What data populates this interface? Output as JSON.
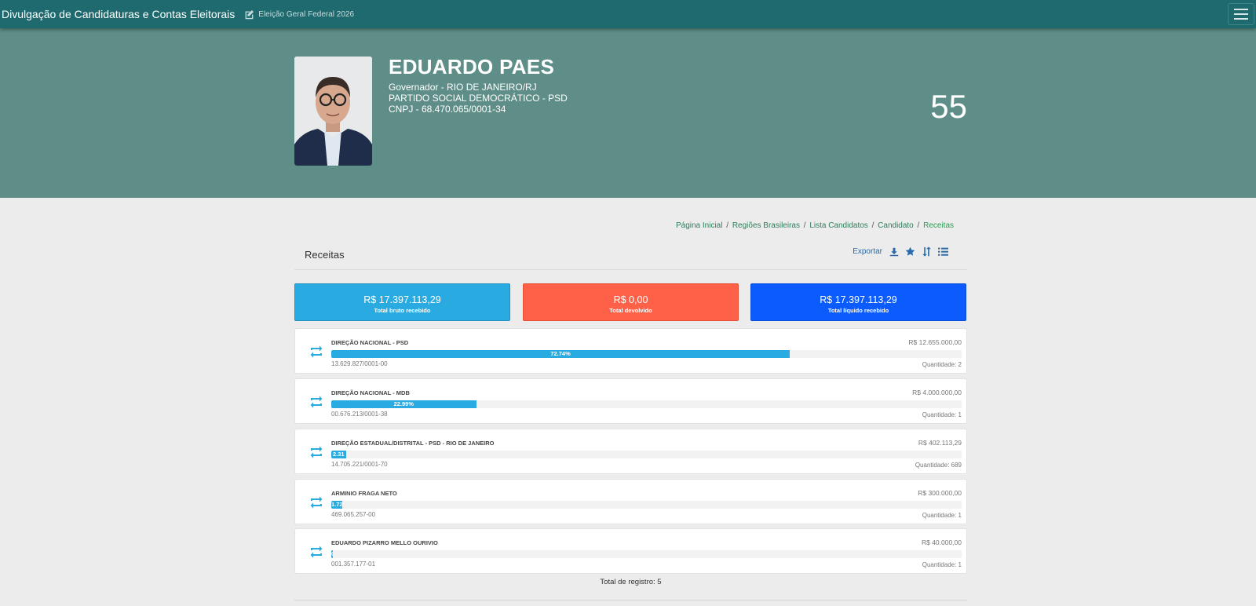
{
  "topbar": {
    "app_title": "Divulgação de Candidaturas e Contas Eleitorais",
    "election_label": "Eleição Geral Federal 2026",
    "edit_icon": "edit-icon",
    "menu_icon": "hamburger-icon"
  },
  "candidate": {
    "name": "EDUARDO PAES",
    "office": "Governador - RIO DE JANEIRO/RJ",
    "party": "PARTIDO SOCIAL DEMOCRÁTICO - PSD",
    "cnpj": "CNPJ - 68.470.065/0001-34",
    "number": "55"
  },
  "breadcrumb": {
    "home": "Página Inicial",
    "regions": "Regiões Brasileiras",
    "list": "Lista Candidatos",
    "candidate": "Candidato",
    "current": "Receitas",
    "separator": "/"
  },
  "section": {
    "title": "Receitas",
    "export_label": "Exportar",
    "icons": [
      "download-icon",
      "star-icon",
      "sort-icon",
      "list-icon"
    ]
  },
  "summary": [
    {
      "amount": "R$ 17.397.113,29",
      "label": "Total bruto recebido",
      "color": "#29abe2"
    },
    {
      "amount": "R$ 0,00",
      "label": "Total devolvido",
      "color": "#fe6048"
    },
    {
      "amount": "R$ 17.397.113,29",
      "label": "Total líquido recebido",
      "color": "#0b5bfd"
    }
  ],
  "donors": [
    {
      "name": "DIREÇÃO NACIONAL - PSD",
      "amount": "R$ 12.655.000,00",
      "percent_label": "72.74%",
      "percent": 72.74,
      "doc": "13.629.827/0001-00",
      "qty": "Quantidade: 2"
    },
    {
      "name": "DIREÇÃO NACIONAL - MDB",
      "amount": "R$ 4.000.000,00",
      "percent_label": "22.99%",
      "percent": 22.99,
      "doc": "00.676.213/0001-38",
      "qty": "Quantidade: 1"
    },
    {
      "name": "DIREÇÃO ESTADUAL/DISTRITAL - PSD - RIO DE JANEIRO",
      "amount": "R$ 402.113,29",
      "percent_label": "2.31",
      "percent": 2.31,
      "doc": "14.705.221/0001-70",
      "qty": "Quantidade: 689"
    },
    {
      "name": "ARMINIO FRAGA NETO",
      "amount": "R$ 300.000,00",
      "percent_label": "1.72",
      "percent": 1.72,
      "doc": "469.065.257-00",
      "qty": "Quantidade: 1"
    },
    {
      "name": "EDUARDO PIZARRO MELLO OURIVIO",
      "amount": "R$ 40.000,00",
      "percent_label": "0.23",
      "percent": 0.23,
      "doc": "001.357.177-01",
      "qty": "Quantidade: 1"
    }
  ],
  "donor_icon": "transfer-icon",
  "total_records": "Total de registro: 5"
}
